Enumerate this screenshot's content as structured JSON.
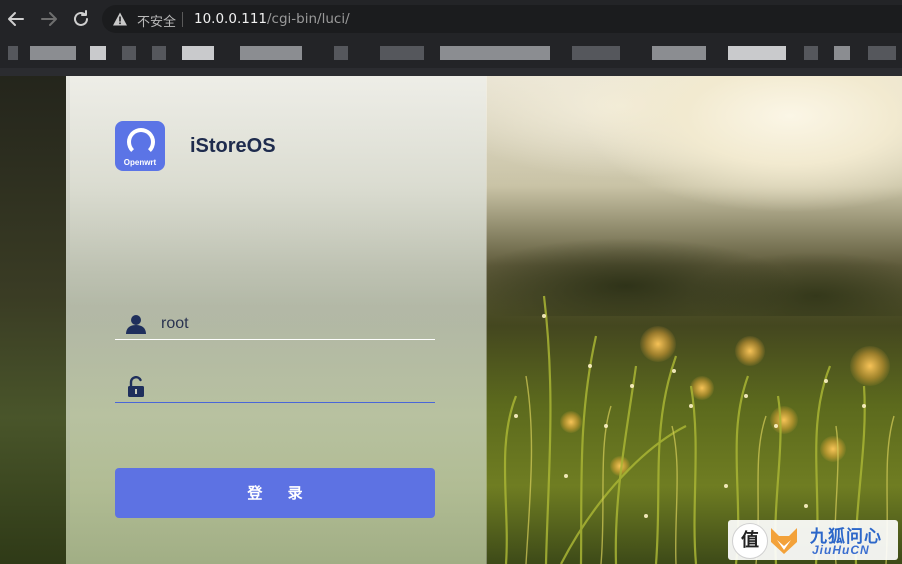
{
  "browser": {
    "security_label": "不安全",
    "url_host": "10.0.0.111",
    "url_path": "/cgi-bin/luci/"
  },
  "icons": {
    "back": "arrow-left-icon",
    "forward": "arrow-right-icon",
    "reload": "reload-icon",
    "warning": "warning-triangle-icon",
    "user": "user-icon",
    "lock": "unlocked-padlock-icon"
  },
  "login": {
    "logo_text": "Openwrt",
    "brand": "iStoreOS",
    "username_value": "root",
    "password_value": "",
    "button_label": "登 录"
  },
  "watermark": {
    "badge_char": "值",
    "cn_text": "九狐问心",
    "en_text": "JiuHuCN"
  },
  "colors": {
    "accent": "#5d72e3",
    "logo_bg": "#5b74e6",
    "brand_text": "#1e2b4d"
  }
}
